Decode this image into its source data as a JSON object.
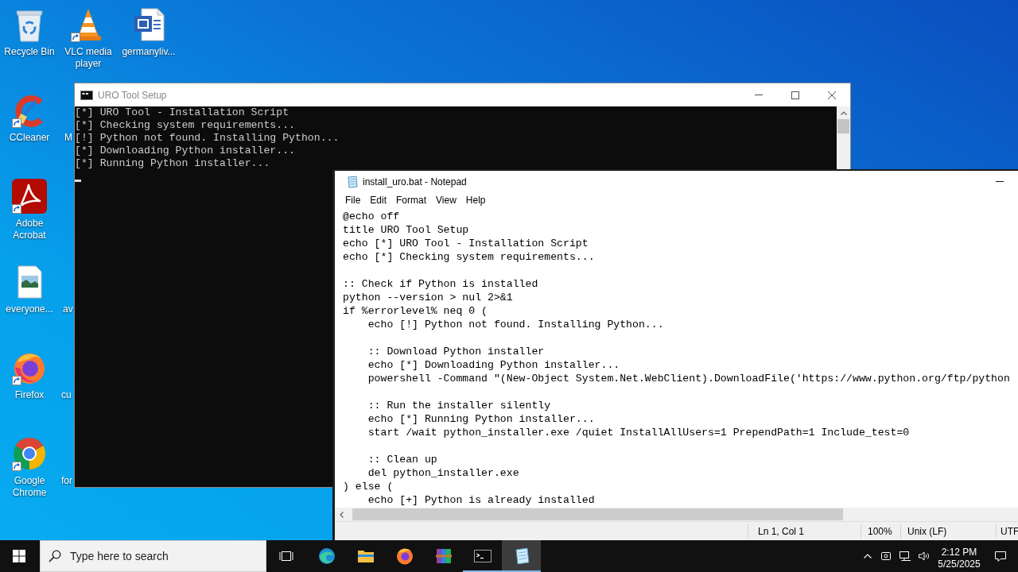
{
  "desktop": {
    "icons": [
      {
        "kind": "recycle_bin",
        "label": "Recycle Bin",
        "shortcut": false
      },
      {
        "kind": "vlc",
        "label": "VLC media player",
        "shortcut": true
      },
      {
        "kind": "word",
        "label": "germanyliv...",
        "shortcut": false
      },
      {
        "kind": "ccleaner",
        "label": "CCleaner",
        "shortcut": true
      },
      {
        "kind": "acrobat",
        "label": "Adobe Acrobat",
        "shortcut": true
      },
      {
        "kind": "image_file",
        "label": "everyone...",
        "shortcut": false
      },
      {
        "kind": "firefox",
        "label": "Firefox",
        "shortcut": true
      },
      {
        "kind": "chrome",
        "label": "Google Chrome",
        "shortcut": true
      }
    ],
    "covered_labels": [
      "M",
      "av",
      "cu",
      "for"
    ]
  },
  "console": {
    "title": "URO Tool Setup",
    "active": false,
    "lines": [
      "[*] URO Tool - Installation Script",
      "[*] Checking system requirements...",
      "[!] Python not found. Installing Python...",
      "[*] Downloading Python installer...",
      "[*] Running Python installer..."
    ],
    "cursor": true
  },
  "notepad": {
    "title": "install_uro.bat - Notepad",
    "active": true,
    "menu": [
      "File",
      "Edit",
      "Format",
      "View",
      "Help"
    ],
    "blocks": [
      [
        "@echo off",
        "title URO Tool Setup",
        "echo [*] URO Tool - Installation Script",
        "echo [*] Checking system requirements..."
      ],
      [
        ":: Check if Python is installed",
        "python --version > nul 2>&1",
        "if %errorlevel% neq 0 (",
        "    echo [!] Python not found. Installing Python..."
      ],
      [
        "    :: Download Python installer",
        "    echo [*] Downloading Python installer...",
        "    powershell -Command \"(New-Object System.Net.WebClient).DownloadFile('https://www.python.org/ftp/python"
      ],
      [
        "    :: Run the installer silently",
        "    echo [*] Running Python installer...",
        "    start /wait python_installer.exe /quiet InstallAllUsers=1 PrependPath=1 Include_test=0"
      ],
      [
        "    :: Clean up",
        "    del python_installer.exe",
        ") else (",
        "    echo [+] Python is already installed"
      ]
    ],
    "status": [
      "Ln 1, Col 1",
      "100%",
      "Unix (LF)",
      "UTF"
    ]
  },
  "taskbar": {
    "search": {
      "placeholder": "Type here to search"
    },
    "apps": [
      {
        "kind": "edge",
        "running": false,
        "selected": false
      },
      {
        "kind": "explorer",
        "running": false,
        "selected": false
      },
      {
        "kind": "firefox",
        "running": false,
        "selected": false
      },
      {
        "kind": "winrar",
        "running": false,
        "selected": false
      },
      {
        "kind": "cmd",
        "running": true,
        "selected": false
      },
      {
        "kind": "notepad",
        "running": true,
        "selected": true
      }
    ],
    "clock": {
      "time": "2:12 PM",
      "date": "5/25/2025"
    }
  }
}
